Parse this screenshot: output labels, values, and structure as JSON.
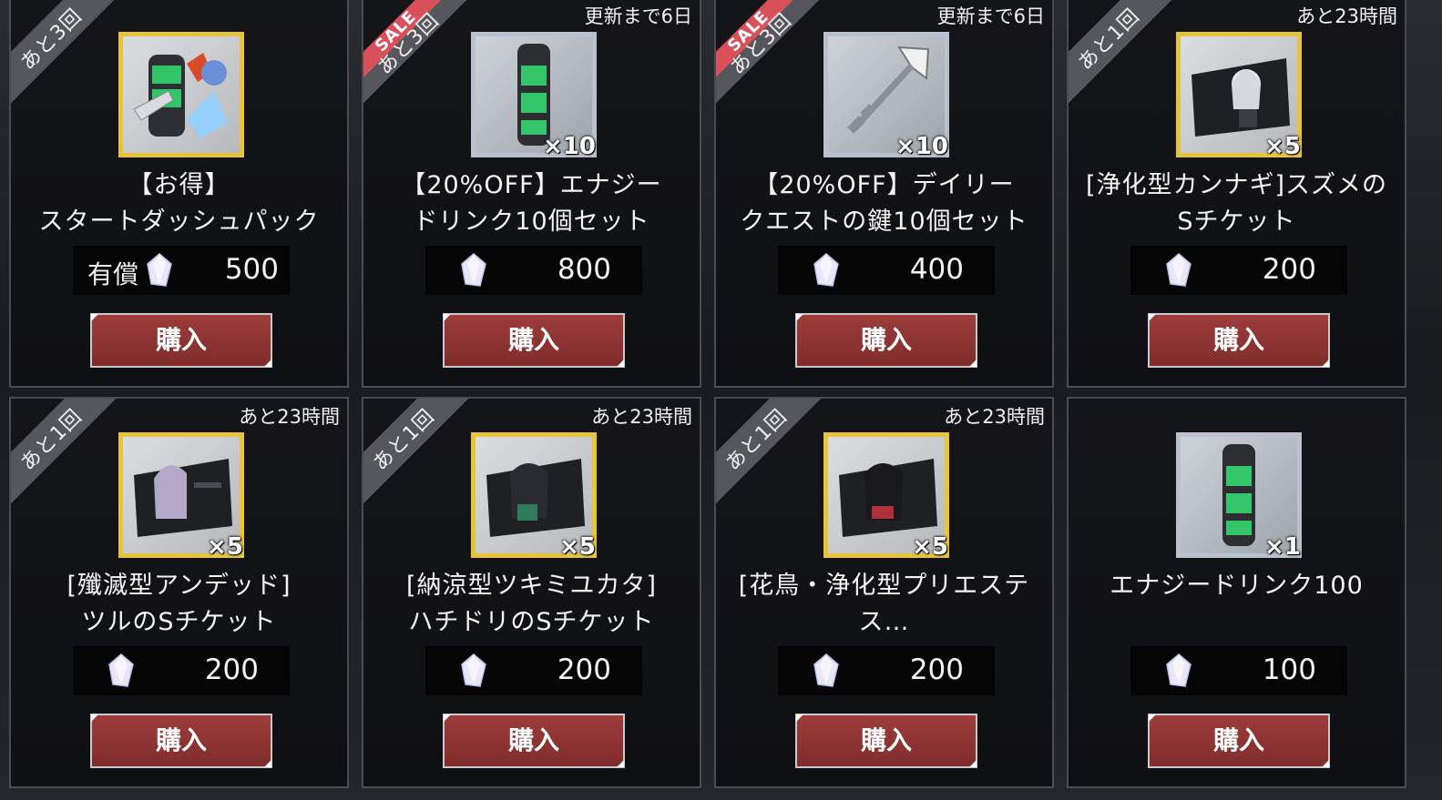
{
  "gem_color": "#e8e4f6",
  "accent_red": "#8f3433",
  "cards": [
    {
      "ribbon": "あと3回",
      "sale": false,
      "timer": "",
      "name1": "【お得】",
      "name2": "スタートダッシュパック",
      "paid": "有償",
      "price": "500",
      "qty": "",
      "frame": "gold",
      "icon": "starter-pack-icon",
      "buy": "購入"
    },
    {
      "ribbon": "あと3回",
      "sale": true,
      "sale_label": "SALE",
      "timer": "更新まで6日",
      "name1": "【20%OFF】エナジー",
      "name2": "ドリンク10個セット",
      "paid": "",
      "price": "800",
      "qty": "×10",
      "frame": "silver",
      "icon": "energy-drink-icon",
      "buy": "購入"
    },
    {
      "ribbon": "あと3回",
      "sale": true,
      "sale_label": "SALE",
      "timer": "更新まで6日",
      "name1": "【20%OFF】デイリー",
      "name2": "クエストの鍵10個セット",
      "paid": "",
      "price": "400",
      "qty": "×10",
      "frame": "silver",
      "icon": "key-icon",
      "buy": "購入"
    },
    {
      "ribbon": "あと1回",
      "sale": false,
      "timer": "あと23時間",
      "name1": "[浄化型カンナギ]スズメの",
      "name2": "Sチケット",
      "paid": "",
      "price": "200",
      "qty": "×5",
      "frame": "gold",
      "icon": "ticket-icon",
      "buy": "購入"
    },
    {
      "ribbon": "あと1回",
      "sale": false,
      "timer": "あと23時間",
      "name1": "[殲滅型アンデッド]",
      "name2": "ツルのSチケット",
      "paid": "",
      "price": "200",
      "qty": "×5",
      "frame": "gold",
      "icon": "ticket-icon",
      "buy": "購入"
    },
    {
      "ribbon": "あと1回",
      "sale": false,
      "timer": "あと23時間",
      "name1": "[納涼型ツキミユカタ]",
      "name2": "ハチドリのSチケット",
      "paid": "",
      "price": "200",
      "qty": "×5",
      "frame": "gold",
      "icon": "ticket-icon",
      "buy": "購入"
    },
    {
      "ribbon": "あと1回",
      "sale": false,
      "timer": "あと23時間",
      "name1": "[花鳥・浄化型プリエステ",
      "name2": "ス…",
      "paid": "",
      "price": "200",
      "qty": "×5",
      "frame": "gold",
      "icon": "ticket-icon",
      "buy": "購入"
    },
    {
      "ribbon": "",
      "sale": false,
      "timer": "",
      "name1": "エナジードリンク100",
      "name2": "",
      "paid": "",
      "price": "100",
      "qty": "×1",
      "frame": "silver",
      "icon": "energy-drink-icon",
      "buy": "購入"
    }
  ]
}
